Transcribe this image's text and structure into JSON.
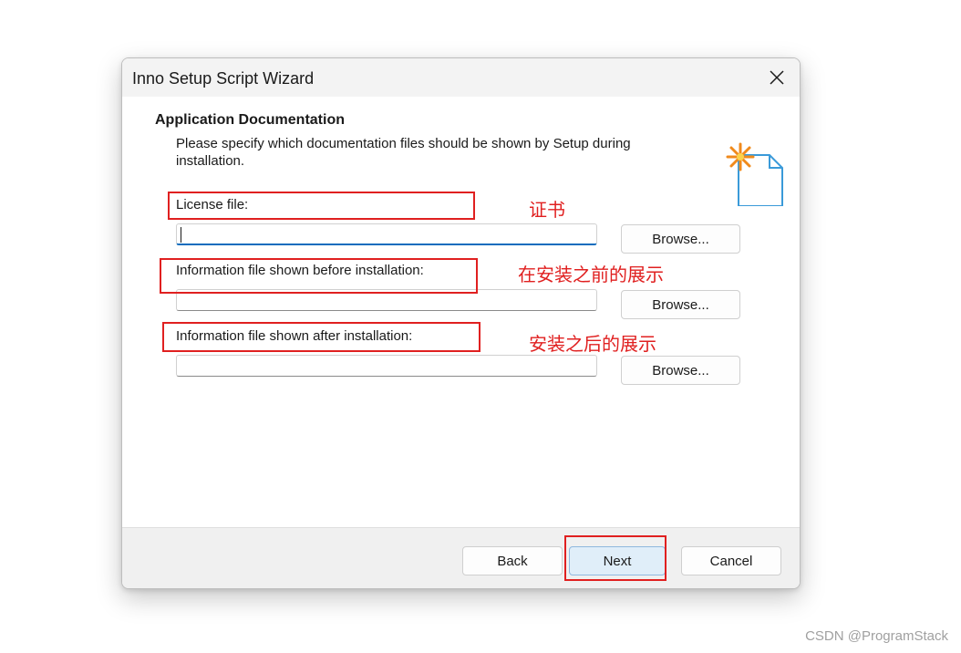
{
  "window": {
    "title": "Inno Setup Script Wizard",
    "close_label": "×"
  },
  "page": {
    "heading": "Application Documentation",
    "description": "Please specify which documentation files should be shown by Setup during installation."
  },
  "fields": [
    {
      "label": "License file:",
      "value": "",
      "browse_label": "Browse...",
      "annotation": "证书"
    },
    {
      "label": "Information file shown before installation:",
      "value": "",
      "browse_label": "Browse...",
      "annotation": "在安装之前的展示"
    },
    {
      "label": "Information file shown after installation:",
      "value": "",
      "browse_label": "Browse...",
      "annotation": "安装之后的展示"
    }
  ],
  "footer": {
    "back_label": "Back",
    "next_label": "Next",
    "cancel_label": "Cancel"
  },
  "watermark": "CSDN @ProgramStack",
  "colors": {
    "annotation": "#e02020",
    "focus": "#0f6cbd",
    "primary_button": "#e0eef9"
  }
}
